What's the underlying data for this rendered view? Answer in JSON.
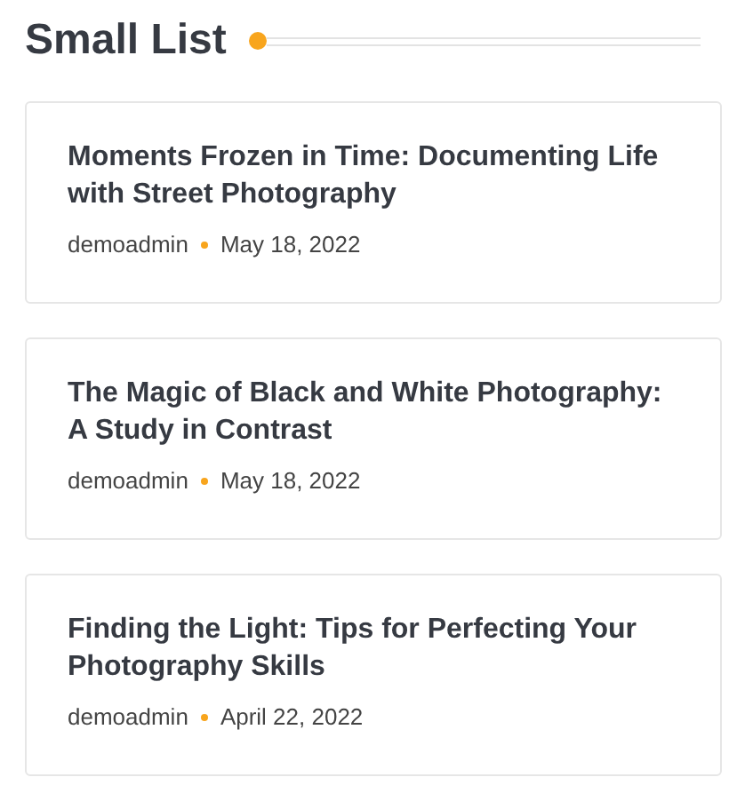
{
  "heading": "Small List",
  "posts": [
    {
      "title": "Moments Frozen in Time: Documenting Life with Street Photography",
      "author": "demoadmin",
      "date": "May 18, 2022"
    },
    {
      "title": "The Magic of Black and White Photography: A Study in Contrast",
      "author": "demoadmin",
      "date": "May 18, 2022"
    },
    {
      "title": "Finding the Light: Tips for Perfecting Your Photography Skills",
      "author": "demoadmin",
      "date": "April 22, 2022"
    }
  ]
}
